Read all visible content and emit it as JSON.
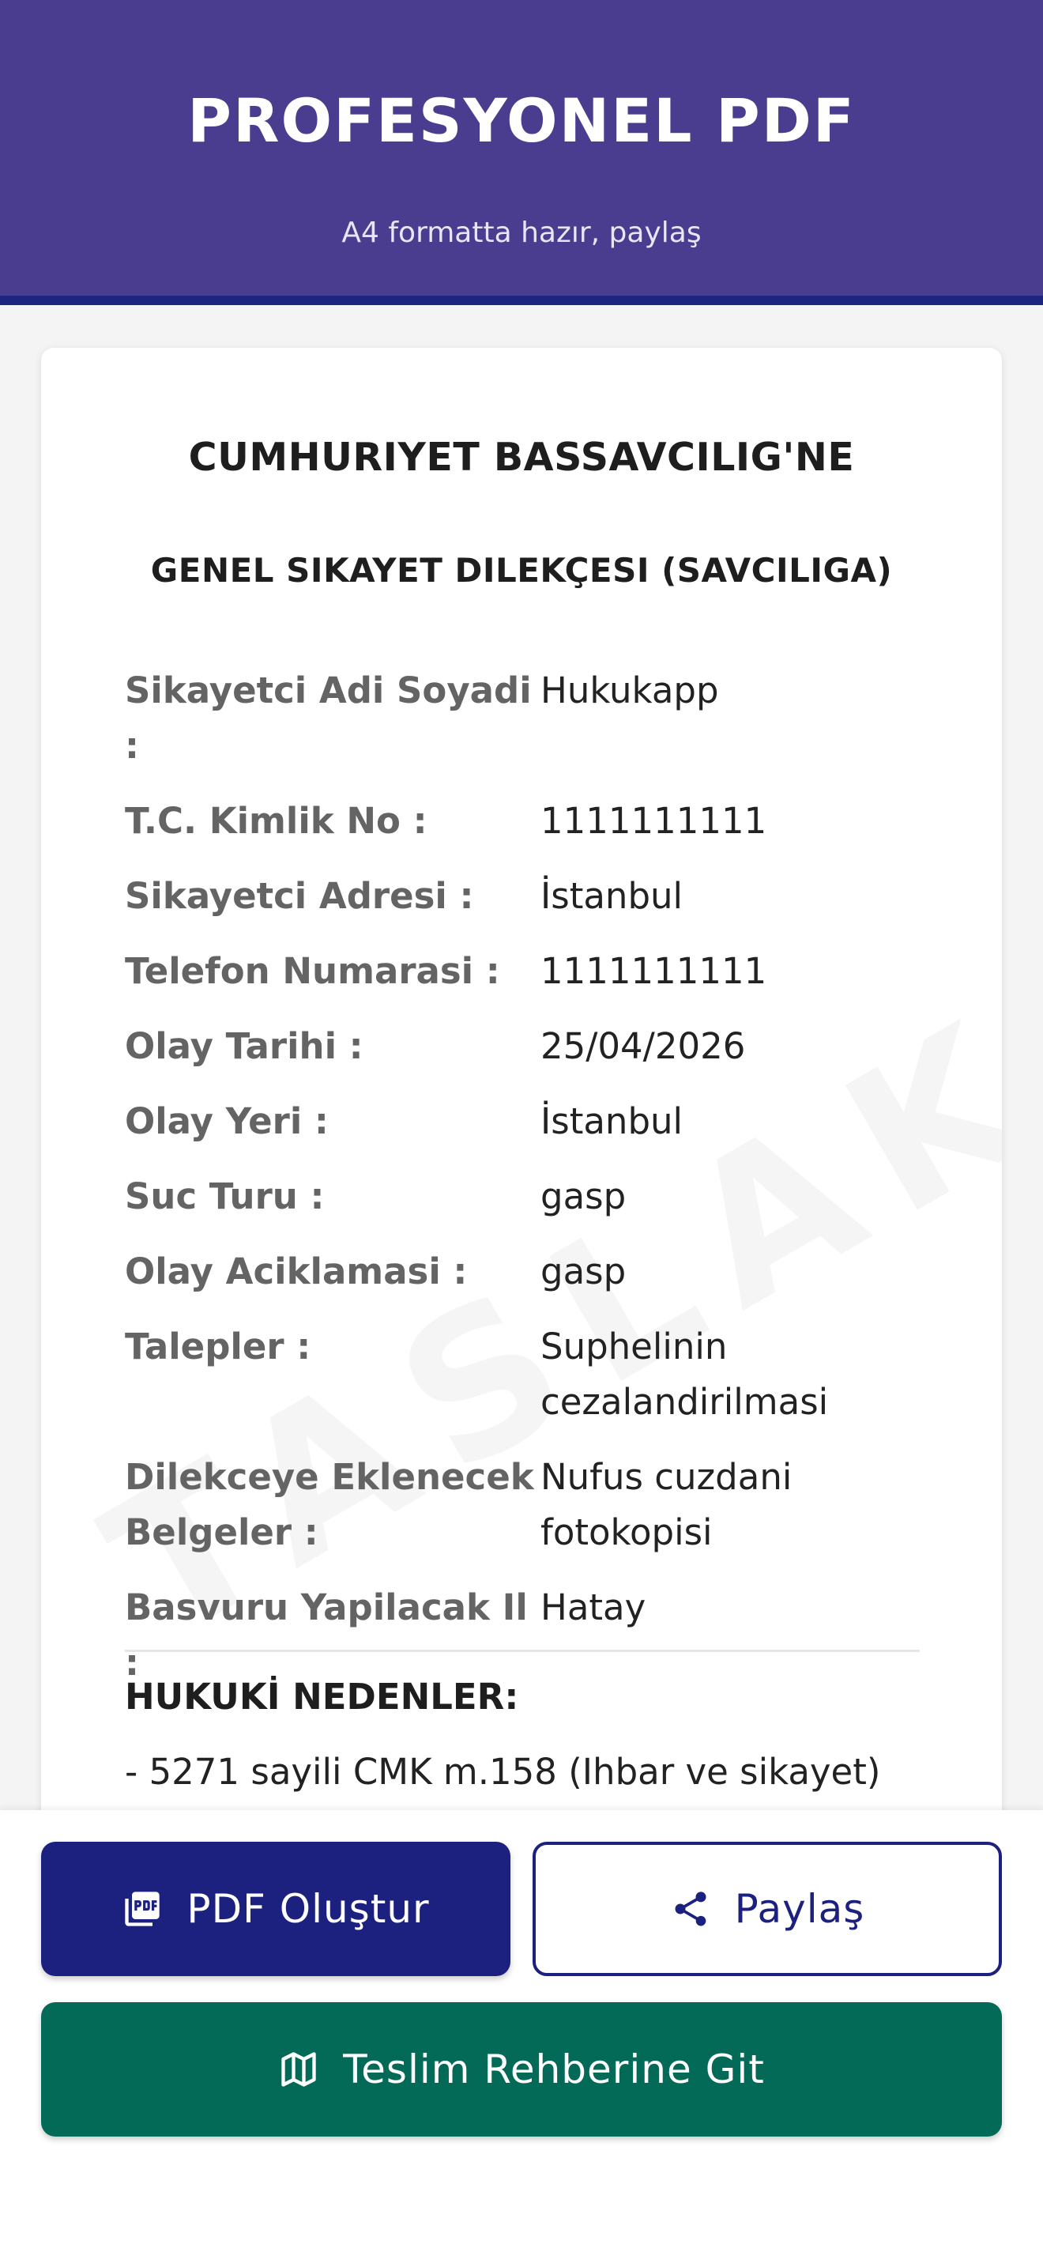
{
  "header": {
    "title": "PROFESYONEL PDF",
    "subtitle": "A4 formatta hazır, paylaş"
  },
  "document": {
    "title": "CUMHURIYET BASSAVCILIG'NE",
    "subtitle": "GENEL SIKAYET DILEKÇESI (SAVCILIGA)",
    "watermark": "TASLAK",
    "fields": [
      {
        "label": "Sikayetci Adi Soyadi :",
        "value": "Hukukapp"
      },
      {
        "label": "T.C. Kimlik No :",
        "value": "1111111111"
      },
      {
        "label": "Sikayetci Adresi :",
        "value": "İstanbul"
      },
      {
        "label": "Telefon Numarasi :",
        "value": "1111111111"
      },
      {
        "label": "Olay Tarihi :",
        "value": "25/04/2026"
      },
      {
        "label": "Olay Yeri :",
        "value": "İstanbul"
      },
      {
        "label": "Suc Turu :",
        "value": "gasp"
      },
      {
        "label": "Olay Aciklamasi :",
        "value": "gasp"
      },
      {
        "label": "Talepler :",
        "value": "Suphelinin cezalandirilmasi"
      },
      {
        "label": "Dilekceye Eklenecek Belgeler :",
        "value": "Nufus cuzdani fotokopisi"
      },
      {
        "label": "Basvuru Yapilacak Il :",
        "value": "Hatay"
      }
    ],
    "legal_heading": "HUKUKİ NEDENLER:",
    "legal_line": "- 5271 sayili CMK m.158 (Ihbar ve sikayet)"
  },
  "actions": {
    "pdf_label": "PDF Oluştur",
    "pdf_icon": "pdf-file-icon",
    "share_label": "Paylaş",
    "share_icon": "share-icon",
    "guide_label": "Teslim Rehberine Git",
    "guide_icon": "map-icon"
  },
  "colors": {
    "header_bg": "#4a3c8e",
    "header_border": "#1c2680",
    "primary": "#1c2180",
    "guide": "#046a58"
  }
}
